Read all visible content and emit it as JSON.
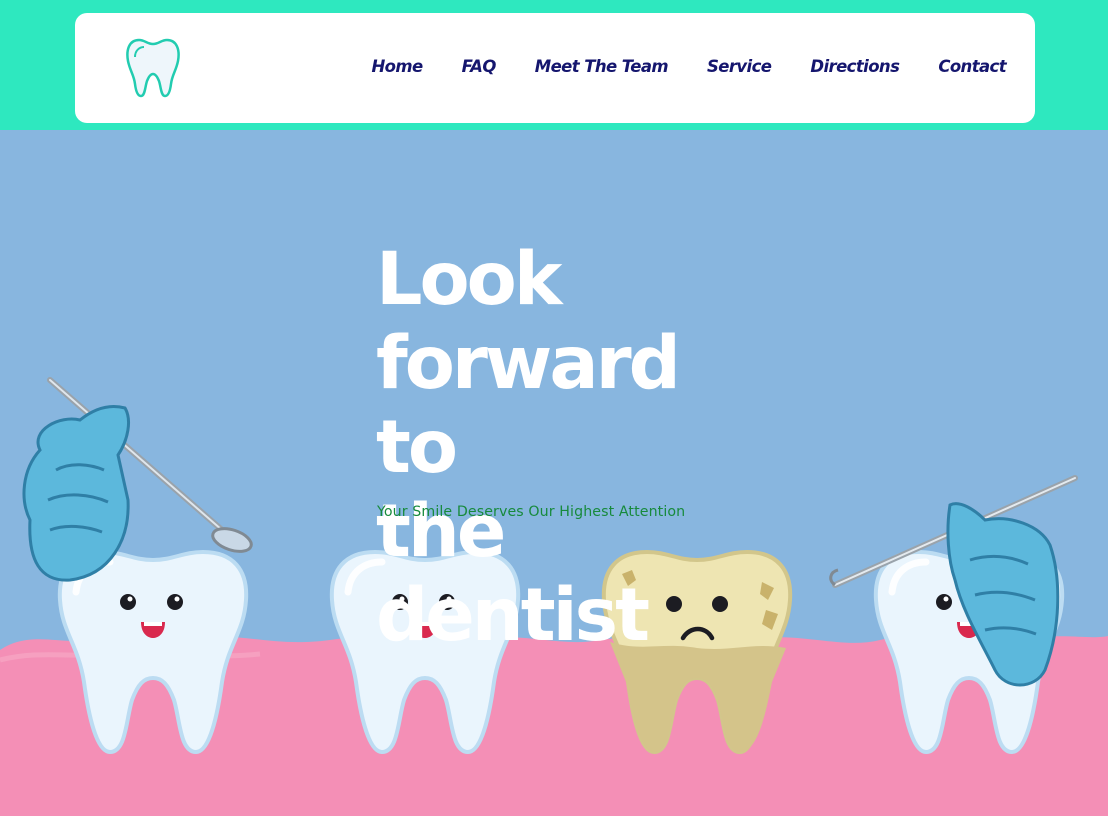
{
  "nav": {
    "logo_icon": "tooth-logo-icon",
    "items": [
      {
        "label": "Home"
      },
      {
        "label": "FAQ"
      },
      {
        "label": "Meet The Team"
      },
      {
        "label": "Service"
      },
      {
        "label": "Directions"
      },
      {
        "label": "Contact"
      }
    ]
  },
  "hero": {
    "title_lines": [
      "Look",
      "forward to",
      "the dentist"
    ],
    "subtitle": "Your Smile Deserves Our Highest Attention"
  },
  "illustration": {
    "icons": [
      "gloved-hand-with-mirror-icon",
      "happy-tooth-icon",
      "happy-tooth-icon",
      "sad-decayed-tooth-icon",
      "happy-tooth-icon",
      "gloved-hand-with-probe-icon"
    ]
  },
  "colors": {
    "header_band": "#2ee8bf",
    "nav_text": "#15166e",
    "hero_background": "#88b6df",
    "gums": "#f48fb6",
    "subtitle": "#178a3c"
  }
}
